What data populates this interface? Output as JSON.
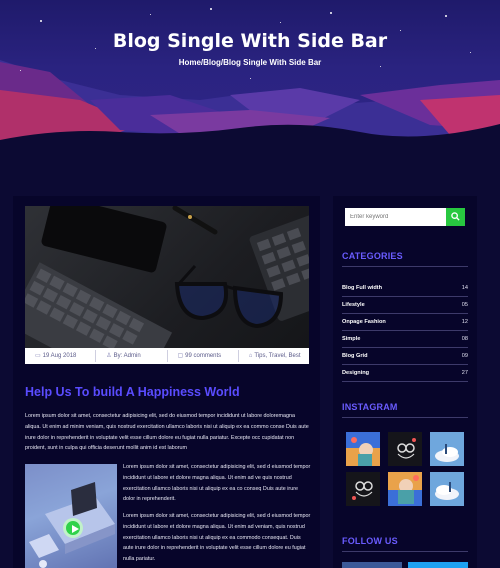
{
  "hero": {
    "title": "Blog Single With Side Bar",
    "breadcrumb": "Home/Blog/Blog Single With Side Bar"
  },
  "post": {
    "meta": [
      {
        "icon": "calendar-icon",
        "text": "19 Aug 2018"
      },
      {
        "icon": "user-icon",
        "text": "By: Admin"
      },
      {
        "icon": "comment-icon",
        "text": "99 comments"
      },
      {
        "icon": "tag-icon",
        "text": "Tips, Travel, Best"
      }
    ],
    "title": "Help Us To build A Happiness World",
    "paragraph1": "Lorem ipsum dolor sit amet, consectetur adipisicing elit, sed do eiusmod tempor incididunt ut labore doloremagna aliqua. Ut enim ad minim veniam, quis nostrud exercitation ullamco laboris nisi ut aliquip ex ea commo conse Duis aute irure dolor in reprehenderit in voluptate velit esse cillum dolore eu fugiat nulla pariatur. Excepte occ cupidatat non proident, sunt in culpa qui officia deserunt mollit anim id est laborum",
    "paragraph2": "Lorem ipsum dolor sit amet, consectetur adipisicing elit, sed d eiusmod tempor incididunt ut labore et dolore magna aliqua. Ut enim ad ve quis nostrud exercitation ullamco laboris nisi ut aliquip ex ea co conseq Duis aute irure dolor in reprehenderit.",
    "paragraph3": "Lorem ipsum dolor sit amet, consectetur adipisicing elit, sed d eiusmod tempor incididunt ut labore et dolore magna aliqua. Ut enim ad veniam, quis nostrud exercitation ullamco laboris nisi ut aliquip ex ea commodo consequat. Duis aute irure dolor in reprehenderit in voluptate velit esse cillum dolore eu fugiat nulla pariatur."
  },
  "sidebar": {
    "search_placeholder": "Enter keyword",
    "categories_title": "CATEGORIES",
    "categories": [
      {
        "name": "Blog Full width",
        "count": "14"
      },
      {
        "name": "Lifestyle",
        "count": "05"
      },
      {
        "name": "Onpage Fashion",
        "count": "12"
      },
      {
        "name": "Simple",
        "count": "08"
      },
      {
        "name": "Blog Grid",
        "count": "09"
      },
      {
        "name": "Designing",
        "count": "27"
      }
    ],
    "instagram_title": "INSTAGRAM",
    "follow_title": "FOLLOW US"
  },
  "colors": {
    "accent": "#5a4cff",
    "search_button": "#28c840",
    "background": "#0c0a33",
    "panel": "#07052a"
  }
}
